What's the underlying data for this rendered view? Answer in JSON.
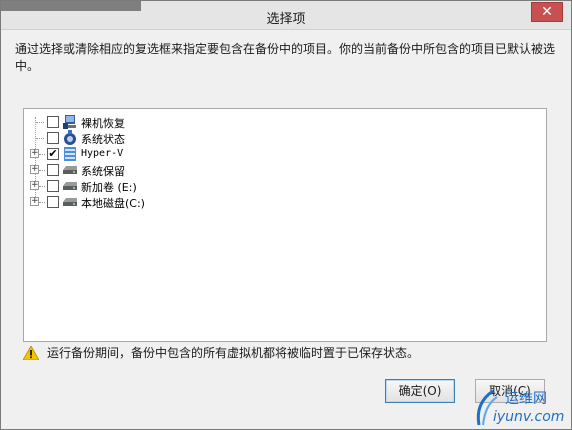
{
  "dialog": {
    "title": "选择项",
    "close_glyph": "✕",
    "instructions": "通过选择或清除相应的复选框来指定要包含在备份中的项目。你的当前备份中所包含的项目已默认被选中。"
  },
  "tree": {
    "items": [
      {
        "label": "裸机恢复",
        "checked": false,
        "expandable": false,
        "icon": "server-icon"
      },
      {
        "label": "系统状态",
        "checked": false,
        "expandable": false,
        "icon": "system-state-icon"
      },
      {
        "label": "Hyper-V",
        "checked": true,
        "expandable": true,
        "icon": "hyperv-icon"
      },
      {
        "label": "系统保留",
        "checked": false,
        "expandable": true,
        "icon": "drive-icon"
      },
      {
        "label": "新加卷 (E:)",
        "checked": false,
        "expandable": true,
        "icon": "drive-icon"
      },
      {
        "label": "本地磁盘(C:)",
        "checked": false,
        "expandable": true,
        "icon": "drive-icon"
      }
    ]
  },
  "warning": {
    "text": "运行备份期间，备份中包含的所有虚拟机都将被临时置于已保存状态。",
    "icon": "warning-icon"
  },
  "buttons": {
    "ok_label": "确定(O)",
    "cancel_label": "取消(C)"
  },
  "watermark": {
    "text_top": "运维网",
    "text_bottom": "iyunv.com"
  },
  "colors": {
    "close_red": "#c75050",
    "warning_yellow": "#f5c400",
    "watermark_blue": "#1f6fc4"
  }
}
